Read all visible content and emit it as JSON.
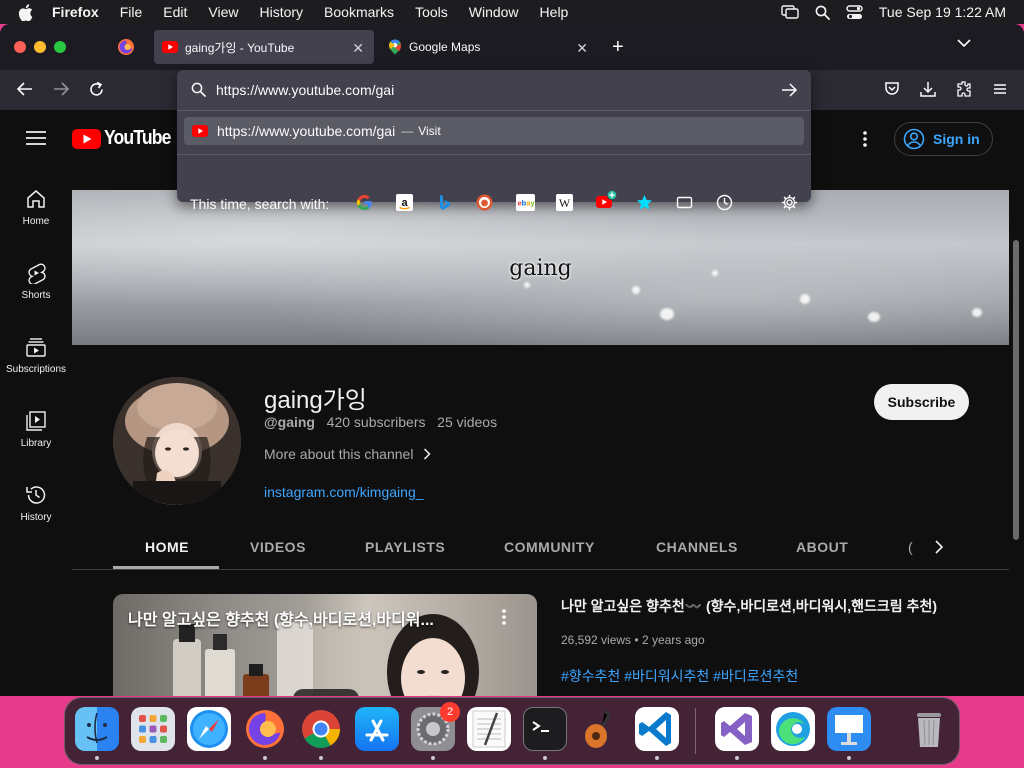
{
  "menubar": {
    "app": "Firefox",
    "items": [
      "File",
      "Edit",
      "View",
      "History",
      "Bookmarks",
      "Tools",
      "Window",
      "Help"
    ],
    "clock": "Tue Sep 19  1:22 AM"
  },
  "tabs": [
    {
      "title": "gaing가잉 - YouTube",
      "icon": "youtube-icon",
      "active": true
    },
    {
      "title": "Google Maps",
      "icon": "google-maps-icon",
      "active": false
    }
  ],
  "urlbar": {
    "value": "https://www.youtube.com/gai",
    "suggestion": "https://www.youtube.com/gai",
    "suggestion_separator": "—",
    "suggestion_action": "Visit",
    "search_with_label": "This time, search with:",
    "engines": [
      "google",
      "amazon",
      "bing",
      "duckduckgo",
      "ebay",
      "wikipedia",
      "youtube-add",
      "bookmarks",
      "tabs",
      "history",
      "settings"
    ]
  },
  "youtube": {
    "logo_text": "YouTube",
    "sign_in": "Sign in",
    "sidebar": [
      {
        "label": "Home",
        "icon": "home-icon"
      },
      {
        "label": "Shorts",
        "icon": "shorts-icon"
      },
      {
        "label": "Subscriptions",
        "icon": "subscriptions-icon"
      },
      {
        "label": "Library",
        "icon": "library-icon"
      },
      {
        "label": "History",
        "icon": "history-icon"
      }
    ],
    "banner_text": "gaing",
    "channel": {
      "name": "gaing가잉",
      "handle": "@gaing",
      "subscribers": "420 subscribers",
      "videos": "25 videos",
      "more_about": "More about this channel",
      "link": "instagram.com/kimgaing_",
      "subscribe": "Subscribe"
    },
    "channel_tabs": [
      "HOME",
      "VIDEOS",
      "PLAYLISTS",
      "COMMUNITY",
      "CHANNELS",
      "ABOUT"
    ],
    "channel_tab_partial": "(",
    "featured_video": {
      "thumb_title": "나만 알고싶은 향추천    (향수,바디로션,바디워...",
      "title": "나만 알고싶은 향추천〰️ (향수,바디로션,바디워시,핸드크림 추천)",
      "views": "26,592 views",
      "age": "2 years ago",
      "meta_separator": "•",
      "tags": "#향수추천 #바디워시추천 #바디로션추천"
    }
  },
  "dock": {
    "apps": [
      "Finder",
      "Launchpad",
      "Safari",
      "Firefox",
      "Chrome",
      "App Store",
      "System Settings",
      "TextEdit",
      "Terminal",
      "GarageBand",
      "Visual Studio Code",
      "Visual Studio",
      "Microsoft Edge",
      "Keynote",
      "Trash"
    ],
    "badge": "2"
  },
  "colors": {
    "accent": "#3ea6ff",
    "youtube_red": "#ff0000",
    "wallpaper": "#e63a8a"
  }
}
